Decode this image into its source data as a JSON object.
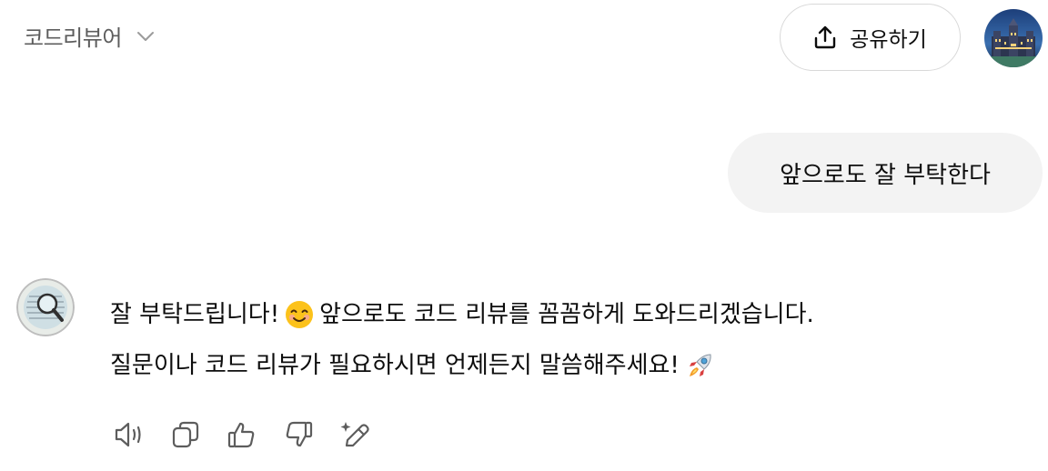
{
  "header": {
    "model_name": "코드리뷰어",
    "share_label": "공유하기",
    "icons": {
      "dropdown": "chevron-down-icon",
      "share": "upload-icon",
      "avatar": "profile-avatar"
    }
  },
  "conversation": {
    "user_message": "앞으로도 잘 부탁한다",
    "assistant": {
      "line1_before_emoji": "잘 부탁드립니다!",
      "line1_emoji": "smiling-face-emoji",
      "line1_after_emoji": "앞으로도 코드 리뷰를 꼼꼼하게 도와드리겠습니다.",
      "line2_text": "질문이나 코드 리뷰가 필요하시면 언제든지 말씀해주세요!",
      "line2_emoji": "rocket-emoji"
    }
  },
  "message_actions": [
    "read-aloud-icon",
    "copy-icon",
    "thumbs-up-icon",
    "thumbs-down-icon",
    "edit-sparkle-icon"
  ],
  "colors": {
    "text": "#0d0d0d",
    "muted": "#5d5d5d",
    "bubble": "#f3f3f3",
    "border": "#d9d9d9"
  }
}
